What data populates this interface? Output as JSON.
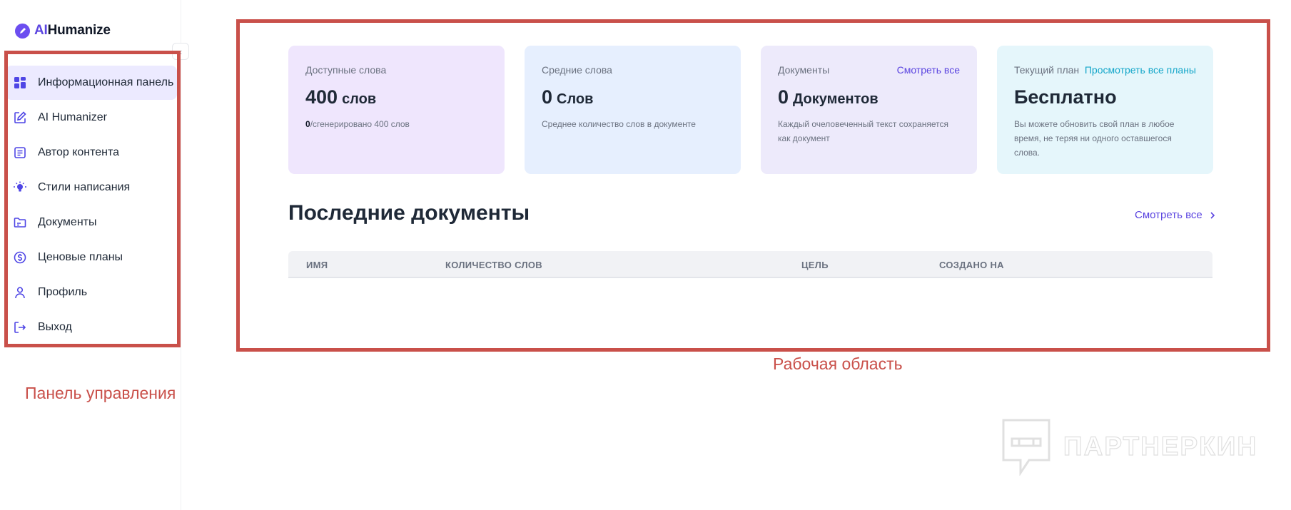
{
  "app": {
    "logo_ai": "AI",
    "logo_rest": "Humanize"
  },
  "sidebar": {
    "collapse_glyph": "‹",
    "items": [
      {
        "label": "Информационная панель",
        "icon": "dashboard-icon",
        "active": true
      },
      {
        "label": "AI Humanizer",
        "icon": "edit-icon"
      },
      {
        "label": "Автор контента",
        "icon": "document-text-icon"
      },
      {
        "label": "Стили написания",
        "icon": "lightbulb-icon"
      },
      {
        "label": "Документы",
        "icon": "folder-icon"
      },
      {
        "label": "Ценовые планы",
        "icon": "dollar-circle-icon"
      },
      {
        "label": "Профиль",
        "icon": "user-icon"
      },
      {
        "label": "Выход",
        "icon": "logout-icon"
      }
    ]
  },
  "cards": {
    "available": {
      "title": "Доступные слова",
      "value": "400",
      "unit": "слов",
      "note_bold": "0",
      "note": "/сгенерировано 400 слов"
    },
    "average": {
      "title": "Средние слова",
      "value": "0",
      "unit": "Слов",
      "note": "Среднее количество слов в документе"
    },
    "documents": {
      "title": "Документы",
      "link": "Смотреть все",
      "value": "0",
      "unit": "Документов",
      "note": "Каждый очеловеченный текст сохраняется как документ"
    },
    "plan": {
      "title": "Текущий план",
      "link": "Просмотреть все планы",
      "value": "Бесплатно",
      "note": "Вы можете обновить свой план в любое время, не теряя ни одного оставшегося слова."
    }
  },
  "recent": {
    "title": "Последние документы",
    "see_all": "Смотреть все",
    "columns": [
      "ИМЯ",
      "КОЛИЧЕСТВО СЛОВ",
      "ЦЕЛЬ",
      "СОЗДАНО НА"
    ],
    "rows": []
  },
  "annotations": {
    "sidebar_label": "Панель управления",
    "workspace_label": "Рабочая область",
    "color": "#c9504a"
  },
  "watermark": {
    "text": "ПАРТНЕРКИН"
  },
  "colors": {
    "accent": "#5b45e0",
    "teal_link": "#13a6c9"
  }
}
